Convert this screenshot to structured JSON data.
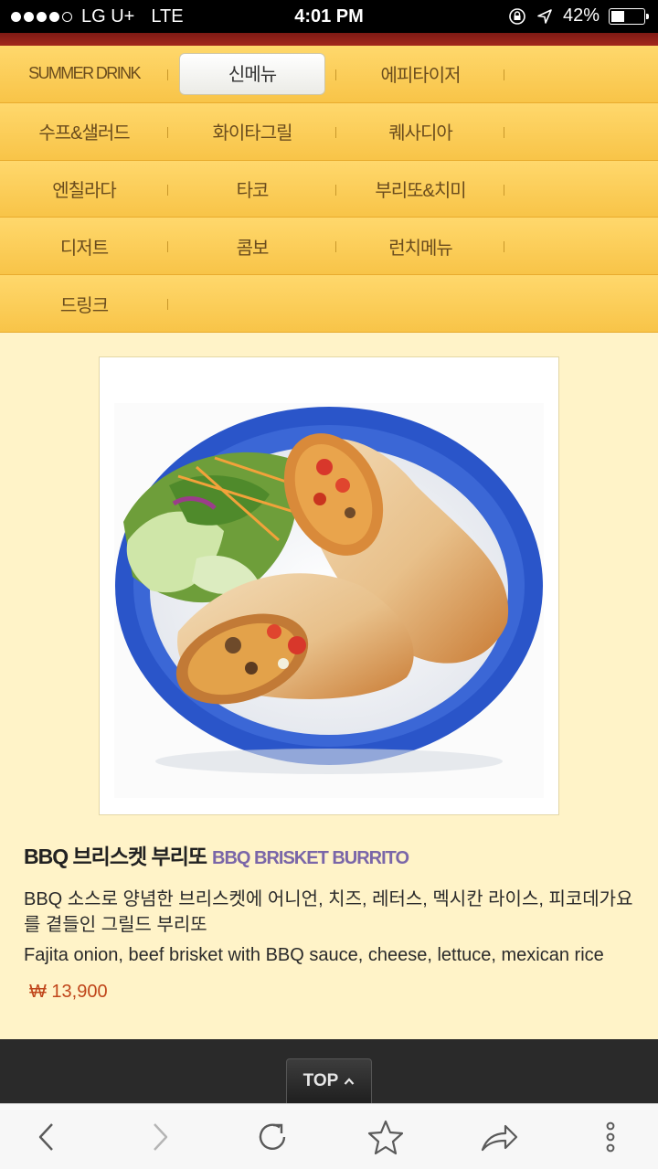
{
  "status_bar": {
    "carrier": "LG U+",
    "network": "LTE",
    "time": "4:01 PM",
    "battery": "42%",
    "battery_level": 0.42
  },
  "menu": {
    "rows": [
      [
        "SUMMER DRINK",
        "신메뉴",
        "에피타이저"
      ],
      [
        "수프&샐러드",
        "화이타그릴",
        "퀘사디아"
      ],
      [
        "엔칠라다",
        "타코",
        "부리또&치미"
      ],
      [
        "디저트",
        "콤보",
        "런치메뉴"
      ],
      [
        "드링크"
      ]
    ],
    "active": "신메뉴"
  },
  "product": {
    "image": "BBQ brisket burrito on blue-rimmed plate with salad",
    "title_ko": "BBQ 브리스켓 부리또",
    "title_en": "BBQ BRISKET BURRITO",
    "desc_ko": "BBQ 소스로 양념한 브리스켓에 어니언, 치즈, 레터스, 멕시칸 라이스, 피코데가요를 곁들인 그릴드 부리또",
    "desc_en": "Fajita onion, beef brisket with BBQ sauce, cheese, lettuce, mexican rice",
    "price": "₩ 13,900"
  },
  "footer": {
    "top_label": "TOP"
  },
  "toolbar": {
    "icons": [
      "back-icon",
      "forward-icon",
      "reload-icon",
      "bookmark-star-icon",
      "share-icon",
      "more-icon"
    ]
  },
  "colors": {
    "menu_bg": "#f8c448",
    "page_bg": "#fff3c8",
    "price": "#c0461b",
    "title_en": "#7a66a8",
    "header_bar": "#a3271c"
  }
}
